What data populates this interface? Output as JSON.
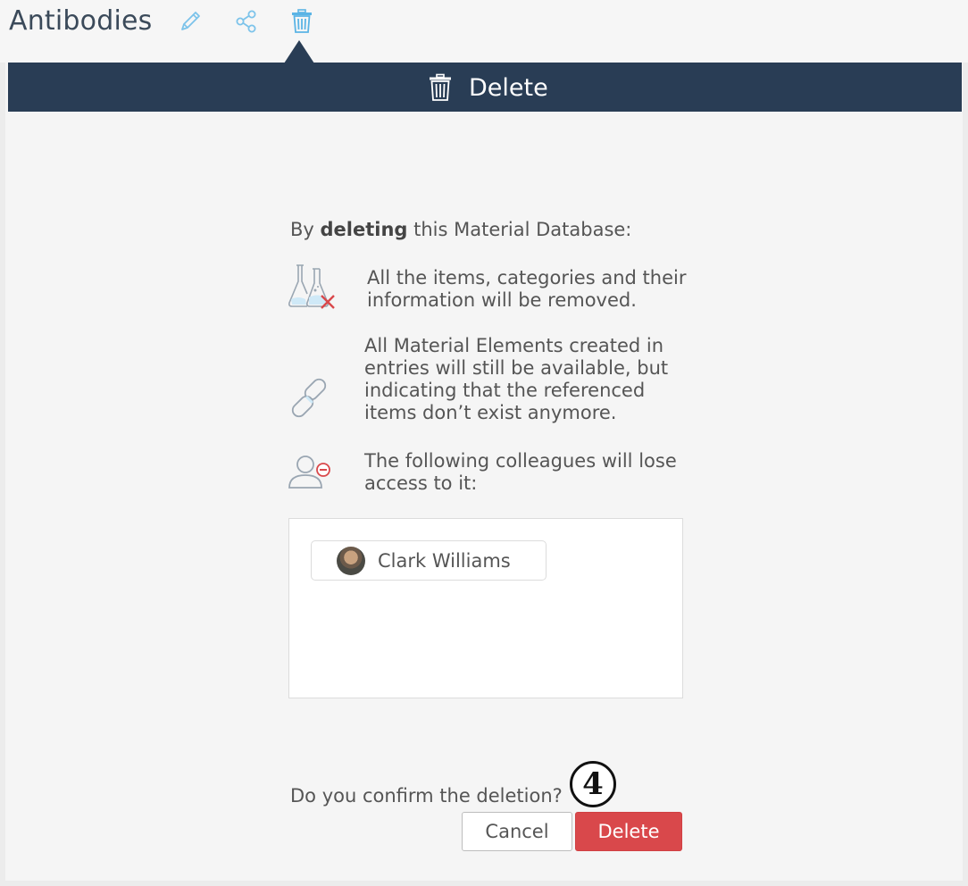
{
  "titlebar": {
    "title": "Antibodies",
    "icons": [
      "pencil-icon",
      "share-icon",
      "trash-icon"
    ]
  },
  "header": {
    "title": "Delete",
    "icon": "trash-icon"
  },
  "dialog": {
    "intro_prefix": "By ",
    "intro_bold": "deleting",
    "intro_suffix": " this Material Database:",
    "items": [
      {
        "icon": "flasks-remove-icon",
        "text": "All the items, categories and their information will be removed."
      },
      {
        "icon": "broken-link-icon",
        "text": "All Material Elements created in entries will still be available, but indicating that the referenced items don’t exist anymore."
      },
      {
        "icon": "user-remove-icon",
        "text": "The following colleagues will lose access to it:"
      }
    ],
    "colleagues": [
      {
        "name": "Clark Williams"
      }
    ],
    "confirm_question": "Do you confirm the deletion?",
    "step_badge": "4",
    "cancel_label": "Cancel",
    "delete_label": "Delete"
  },
  "colors": {
    "header_bg": "#293d55",
    "delete_red": "#d9484b",
    "icon_blue": "#5bb4e5"
  }
}
